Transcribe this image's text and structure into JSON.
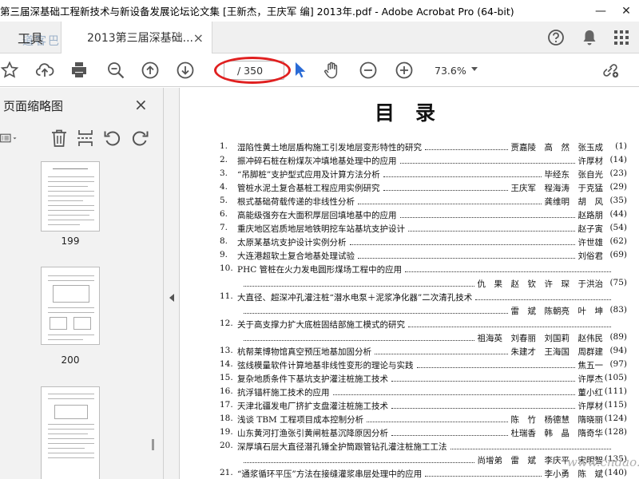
{
  "window": {
    "title": "第三届深基础工程新技术与新设备发展论坛论文集 [王新杰，王庆军 编] 2013年.pdf - Adobe Acrobat Pro (64-bit)",
    "minimize": "—",
    "close": "✕"
  },
  "tabs": {
    "tools": "工具",
    "document": "2013第三届深基础...",
    "close": "×"
  },
  "toolbar": {
    "page_total": "/ 350",
    "zoom": "73.6%"
  },
  "sidebar": {
    "title": "页面缩略图",
    "close": "×",
    "thumbnails": [
      {
        "label": "199"
      },
      {
        "label": "200"
      }
    ]
  },
  "document": {
    "heading": "目录",
    "toc": [
      {
        "num": "1.",
        "title": "湿陷性黄土地层盾构施工引发地层变形特性的研究",
        "author": "贾嘉陵　高　然　张玉成",
        "page": "(1)"
      },
      {
        "num": "2.",
        "title": "振冲碎石桩在粉煤灰冲填地基处理中的应用",
        "author": "许厚材",
        "page": "(14)"
      },
      {
        "num": "3.",
        "title": "“吊脚桩”支护型式应用及计算方法分析",
        "author": "毕经东　张自光",
        "page": "(23)"
      },
      {
        "num": "4.",
        "title": "管桩水泥土复合基桩工程应用实例研究",
        "author": "王庆军　程海涛　于克猛",
        "page": "(29)"
      },
      {
        "num": "5.",
        "title": "根式基础荷载传递的非线性分析",
        "author": "龚维明　胡　风",
        "page": "(35)"
      },
      {
        "num": "6.",
        "title": "高能级强夯在大面积厚层回填地基中的应用",
        "author": "赵路朋",
        "page": "(44)"
      },
      {
        "num": "7.",
        "title": "重庆地区岩质地层地铁明挖车站基坑支护设计",
        "author": "赵子寅",
        "page": "(54)"
      },
      {
        "num": "8.",
        "title": "太原某基坑支护设计实例分析",
        "author": "许世雄",
        "page": "(62)"
      },
      {
        "num": "9.",
        "title": "大连港超软土复合地基处理试验",
        "author": "刘俗君",
        "page": "(69)"
      },
      {
        "num": "10.",
        "title": "PHC 管桩在火力发电圆形煤场工程中的应用",
        "author": "",
        "page": ""
      },
      {
        "num": "",
        "title": "",
        "author": "仇　果　赵　钦　许　琛　于洪治",
        "page": "(75)"
      },
      {
        "num": "11.",
        "title": "大直径、超深冲孔灌注桩“潜水电泵＋泥浆净化器”二次清孔技术",
        "author": "",
        "page": ""
      },
      {
        "num": "",
        "title": "",
        "author": "雷　斌　陈朝亮　叶　坤",
        "page": "(83)"
      },
      {
        "num": "12.",
        "title": "关于高支撑力扩大底桩固结部施工模式的研究",
        "author": "",
        "page": ""
      },
      {
        "num": "",
        "title": "",
        "author": "祖海英　刘春丽　刘国莉　赵伟民",
        "page": "(89)"
      },
      {
        "num": "13.",
        "title": "杭帮莱博物馆真空预压地基加固分析",
        "author": "朱建才　王海国　周群建",
        "page": "(94)"
      },
      {
        "num": "14.",
        "title": "弦线模量软件计算地基非线性变形的理论与实践",
        "author": "焦五一",
        "page": "(97)"
      },
      {
        "num": "15.",
        "title": "复杂地质条件下基坑支护灌注桩施工技术",
        "author": "许厚杰",
        "page": "(105)"
      },
      {
        "num": "16.",
        "title": "抗浮锚杆施工技术的应用",
        "author": "董小红",
        "page": "(111)"
      },
      {
        "num": "17.",
        "title": "天津北疆发电厂挤扩支盘灌注桩施工技术",
        "author": "许厚材",
        "page": "(115)"
      },
      {
        "num": "18.",
        "title": "浅谈 TBM 工程项目成本控制分析",
        "author": "陈　竹　杨德慧　隋晓丽",
        "page": "(124)"
      },
      {
        "num": "19.",
        "title": "山东黄河打渔张引黄闸桩基沉降原因分析",
        "author": "杜瑞香　韩　晶　隋奇华",
        "page": "(128)"
      },
      {
        "num": "20.",
        "title": "深厚填石层大直径潜孔锤全护筒跟管钻孔灌注桩施工工法",
        "author": "",
        "page": ""
      },
      {
        "num": "",
        "title": "",
        "author": "尚增弟　雷　斌　李庆平　宋明智",
        "page": "(135)"
      },
      {
        "num": "21.",
        "title": "“通浆循环平压”方法在接缝灌浆串层处理中的应用",
        "author": "李小勇　陈　斌",
        "page": "(140)"
      }
    ],
    "watermark": "www.cndao.com",
    "watermark_top": "道客巴巴"
  },
  "colors": {
    "annotation_ellipse": "#e02020",
    "cursor": "#2a6bd6"
  }
}
